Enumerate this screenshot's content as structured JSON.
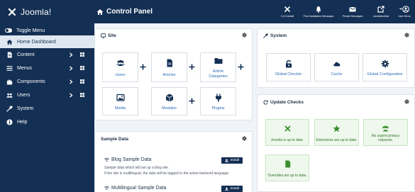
{
  "header": {
    "logo_text": "Joomla!",
    "page_title": "Control Panel",
    "tools": [
      {
        "label": "4.0.0-beta8",
        "icon": "joomla-icon"
      },
      {
        "label": "Post Installation Messages",
        "icon": "bell-icon"
      },
      {
        "label": "Private Messages",
        "icon": "envelope-icon"
      },
      {
        "label": "Joomlatoolbar",
        "icon": "external-link-icon"
      },
      {
        "label": "User Menu",
        "icon": "user-icon"
      }
    ]
  },
  "sidebar": {
    "toggle_label": "Toggle Menu",
    "items": [
      {
        "label": "Home Dashboard",
        "icon": "home-icon"
      },
      {
        "label": "Content",
        "icon": "file-icon"
      },
      {
        "label": "Menus",
        "icon": "list-icon"
      },
      {
        "label": "Components",
        "icon": "puzzle-icon"
      },
      {
        "label": "Users",
        "icon": "users-icon"
      },
      {
        "label": "System",
        "icon": "wrench-icon"
      },
      {
        "label": "Help",
        "icon": "info-icon"
      }
    ]
  },
  "site": {
    "title": "Site",
    "tiles": [
      {
        "label": "Users",
        "icon": "users-icon"
      },
      {
        "label": "Articles",
        "icon": "file-icon"
      },
      {
        "label": "Article Categories",
        "icon": "folder-icon"
      },
      {
        "label": "Media",
        "icon": "image-icon"
      },
      {
        "label": "Modules",
        "icon": "cube-icon"
      },
      {
        "label": "Plugins",
        "icon": "plug-icon"
      }
    ]
  },
  "system": {
    "title": "System",
    "tiles": [
      {
        "label": "Global Checkin",
        "icon": "unlock-icon"
      },
      {
        "label": "Cache",
        "icon": "cloud-icon"
      },
      {
        "label": "Global Configuration",
        "icon": "cog-icon"
      }
    ]
  },
  "updates": {
    "title": "Update Checks",
    "tiles": [
      {
        "label": "Joomla is up to date.",
        "icon": "joomla-icon"
      },
      {
        "label": "Extensions are up to date.",
        "icon": "star-icon"
      },
      {
        "label": "No urgent privacy requests.",
        "icon": "users-icon"
      },
      {
        "label": "Overrides are up to date.",
        "icon": "file-icon"
      }
    ]
  },
  "sample": {
    "title": "Sample Data",
    "blog_title": "Blog Sample Data",
    "blog_desc1": "Sample data which will set up a blog site.",
    "blog_desc2": "If the site is multilingual, the data will be tagged to the active backend language.",
    "multi_title": "Multilingual Sample Data",
    "install_label": "Install"
  },
  "colors": {
    "brand": "#132f53",
    "link": "#2a69b8",
    "success": "#3b8f30"
  }
}
